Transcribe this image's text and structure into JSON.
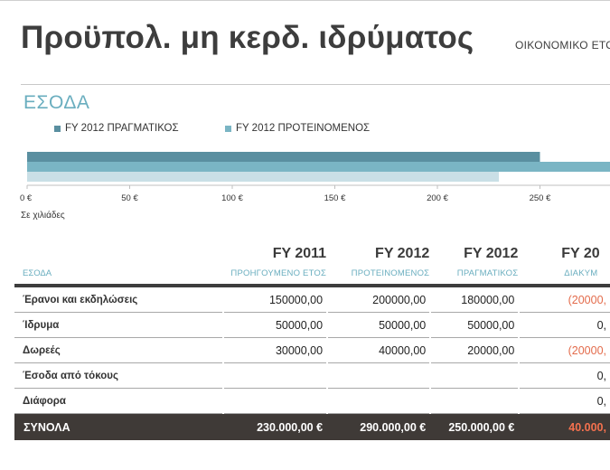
{
  "title": "Προϋπολ. μη κερδ. ιδρύματος",
  "subtitle": "ΟΙΚΟΝΟΜΙΚΟ ΕΤΟ",
  "section_title": "ΕΣΟΔΑ",
  "legend": [
    {
      "label": "FY 2012 ΠΡΑΓΜΑΤΙΚΟΣ",
      "color": "#5a8fa0"
    },
    {
      "label": "FY 2012 ΠΡΟΤΕΙΝΟΜΕΝΟΣ",
      "color": "#7ab5c4"
    }
  ],
  "chart_data": {
    "type": "bar",
    "orientation": "horizontal",
    "series": [
      {
        "name": "FY 2012 ΠΡΑΓΜΑΤΙΚΟΣ",
        "values": [
          250
        ],
        "color": "#5a8fa0"
      },
      {
        "name": "FY 2012 ΠΡΟΤΕΙΝΟΜΕΝΟΣ",
        "values": [
          290
        ],
        "color": "#7ab5c4"
      },
      {
        "values": [
          230
        ],
        "color": "#c9dfe6"
      }
    ],
    "xlim": [
      0,
      300
    ],
    "x_ticks": [
      "0 €",
      "50 €",
      "100 €",
      "150 €",
      "200 €",
      "250 €"
    ],
    "unit_label": "Σε χιλιάδες"
  },
  "table": {
    "category_header": "ΕΣΟΔΑ",
    "columns": [
      {
        "fy": "FY 2011",
        "sub": "ΠΡΟΗΓΟΥΜΕΝΟ ΕΤΟΣ"
      },
      {
        "fy": "FY 2012",
        "sub": "ΠΡΟΤΕΙΝΟΜΕΝΟΣ"
      },
      {
        "fy": "FY 2012",
        "sub": "ΠΡΑΓΜΑΤΙΚΟΣ"
      },
      {
        "fy": "FY 20",
        "sub": "ΔΙΑΚΥΜ"
      }
    ],
    "rows": [
      {
        "label": "Έρανοι και εκδηλώσεις",
        "values": [
          "150000,00",
          "200000,00",
          "180000,00",
          "(20000,"
        ]
      },
      {
        "label": "Ίδρυμα",
        "values": [
          "50000,00",
          "50000,00",
          "50000,00",
          "0,"
        ]
      },
      {
        "label": "Δωρεές",
        "values": [
          "30000,00",
          "40000,00",
          "20000,00",
          "(20000,"
        ]
      },
      {
        "label": "Έσοδα από τόκους",
        "values": [
          "",
          "",
          "",
          "0,"
        ]
      },
      {
        "label": "Διάφορα",
        "values": [
          "",
          "",
          "",
          "0,"
        ]
      }
    ],
    "total": {
      "label": "ΣΥΝΟΛΑ",
      "values": [
        "230.000,00 €",
        "290.000,00 €",
        "250.000,00 €",
        "40.000,"
      ]
    }
  }
}
